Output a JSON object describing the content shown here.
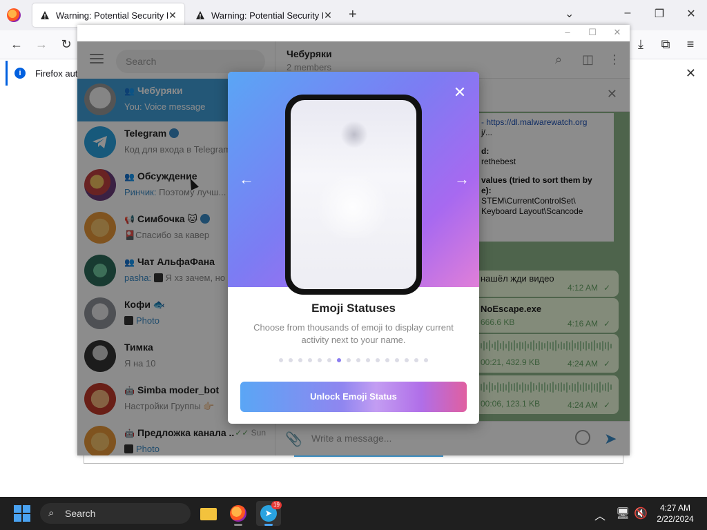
{
  "browser": {
    "tabs": [
      {
        "title": "Warning: Potential Security Risk"
      },
      {
        "title": "Warning: Potential Security Risk"
      }
    ],
    "notice": "Firefox autor"
  },
  "telegram": {
    "search_placeholder": "Search",
    "chats": [
      {
        "name": "Чебуряки",
        "preview": "You: Voice message",
        "active": true
      },
      {
        "name": "Telegram",
        "preview": "Код для входа в Telegram"
      },
      {
        "name": "Обсуждение",
        "sender": "Ринчик:",
        "preview": "Поэтому лучш..."
      },
      {
        "name": "Симбочка 🐱",
        "preview": "🎴Спасибо за кавер"
      },
      {
        "name": "Чат АльфаФана",
        "sender": "pasha:",
        "preview": "Я хз зачем, но"
      },
      {
        "name": "Кофи 🐟",
        "preview": "Photo"
      },
      {
        "name": "Тимка",
        "preview": "Я на 10"
      },
      {
        "name": "Simba moder_bot",
        "preview": "Настройки Группы 👉🏻"
      },
      {
        "name": "Предложка канала ...",
        "preview": "Photo",
        "time": "Sun"
      }
    ],
    "chat_header": {
      "title": "Чебуряки",
      "subtitle": "2 members"
    },
    "doc_lines": [
      "- https://dl.malwarewatch.org",
      "j/...",
      "d:",
      "rethebest",
      "values (tried to sort them by",
      "e):",
      "STEM\\CurrentControlSet\\",
      "Keyboard Layout\\Scancode"
    ],
    "messages": [
      {
        "text": "нашёл жди видео",
        "time": "4:12 AM"
      },
      {
        "text": "NoEscape.exe",
        "size": "666.6 KB",
        "time": "4:16 AM"
      },
      {
        "text": "00:21, 432.9 KB",
        "time": "4:24 AM"
      },
      {
        "text": "00:06, 123.1 KB",
        "time": "4:24 AM"
      }
    ],
    "input_placeholder": "Write a message..."
  },
  "modal": {
    "title": "Emoji Statuses",
    "description": "Choose from thousands of emoji to display current activity next to your name.",
    "button": "Unlock Emoji Status",
    "dots_total": 16,
    "dots_active_index": 6
  },
  "taskbar": {
    "search_label": "Search",
    "telegram_badge": "19",
    "time": "4:27 AM",
    "date": "2/22/2024"
  },
  "colors": {
    "accent": "#419fd9",
    "modal_gradient_start": "#5aa6f5",
    "modal_gradient_end": "#e05fa0"
  }
}
